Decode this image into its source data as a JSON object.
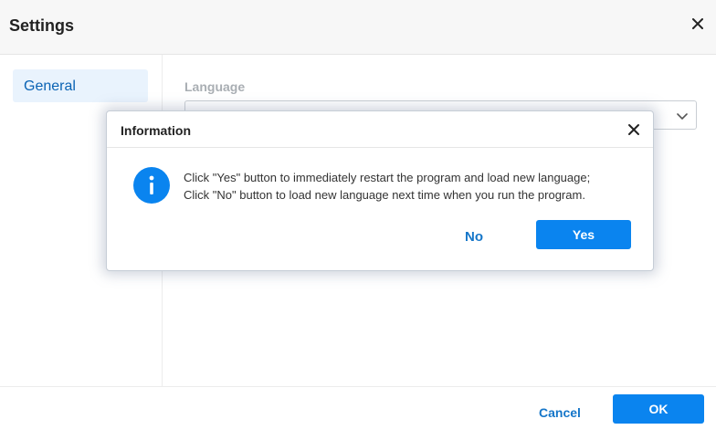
{
  "window": {
    "title": "Settings"
  },
  "sidebar": {
    "items": [
      {
        "label": "General",
        "selected": true
      }
    ]
  },
  "main": {
    "language_label": "Language",
    "language_value": ""
  },
  "footer": {
    "cancel_label": "Cancel",
    "ok_label": "OK"
  },
  "dialog": {
    "title": "Information",
    "icon": "info-icon",
    "message_lines": [
      "Click \"Yes\" button to immediately restart the program and load new language;",
      "Click \"No\" button to load new language next time when you run the program."
    ],
    "no_label": "No",
    "yes_label": "Yes"
  },
  "colors": {
    "accent": "#0a84ef",
    "link": "#1576c9",
    "selected_bg": "#e9f3fd"
  }
}
